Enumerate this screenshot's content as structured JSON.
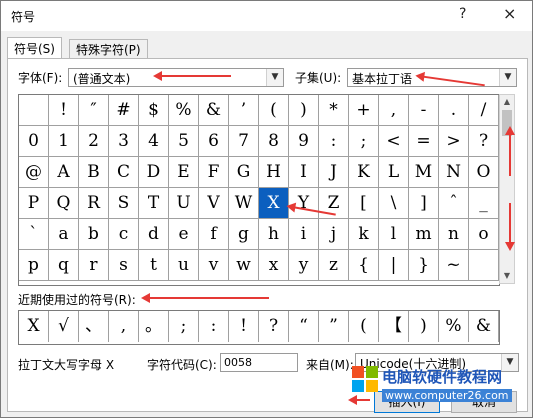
{
  "window": {
    "title": "符号",
    "help_glyph": "?",
    "close_glyph": "×"
  },
  "tabs": [
    {
      "label": "符号(S)"
    },
    {
      "label": "特殊字符(P)"
    }
  ],
  "font": {
    "label": "字体(F):",
    "value": "(普通文本)"
  },
  "subset": {
    "label": "子集(U):",
    "value": "基本拉丁语"
  },
  "grid_rows": [
    [
      " ",
      "!",
      "″",
      "#",
      "$",
      "%",
      "&",
      "’",
      "(",
      ")",
      "*",
      "+",
      ",",
      "-",
      ".",
      "/"
    ],
    [
      "0",
      "1",
      "2",
      "3",
      "4",
      "5",
      "6",
      "7",
      "8",
      "9",
      ":",
      ";",
      "<",
      "=",
      ">",
      "?"
    ],
    [
      "@",
      "A",
      "B",
      "C",
      "D",
      "E",
      "F",
      "G",
      "H",
      "I",
      "J",
      "K",
      "L",
      "M",
      "N",
      "O"
    ],
    [
      "P",
      "Q",
      "R",
      "S",
      "T",
      "U",
      "V",
      "W",
      "X",
      "Y",
      "Z",
      "[",
      "\\",
      "]",
      "ˆ",
      "_"
    ],
    [
      "ˋ",
      "a",
      "b",
      "c",
      "d",
      "e",
      "f",
      "g",
      "h",
      "i",
      "j",
      "k",
      "l",
      "m",
      "n",
      "o"
    ],
    [
      "p",
      "q",
      "r",
      "s",
      "t",
      "u",
      "v",
      "w",
      "x",
      "y",
      "z",
      "{",
      "|",
      "}",
      "~",
      ""
    ]
  ],
  "selected_char": "X",
  "recent": {
    "label": "近期使用过的符号(R):",
    "symbols": [
      "X",
      "√",
      "、",
      ",",
      "。",
      ";",
      ":",
      "!",
      "?",
      "“",
      "”",
      "(",
      "【",
      ")",
      "%",
      "&"
    ]
  },
  "char_name": "拉丁文大写字母 X",
  "char_code": {
    "label": "字符代码(C):",
    "value": "0058"
  },
  "from": {
    "label": "来自(M):",
    "value": "Unicode(十六进制)"
  },
  "buttons": {
    "insert": "插入(I)",
    "cancel": "取消"
  },
  "watermark": {
    "title": "电脑软硬件教程网",
    "url": "www.computer26.com"
  },
  "colors": {
    "selection": "#0b5fbf",
    "annotation_arrow": "#e53935"
  }
}
